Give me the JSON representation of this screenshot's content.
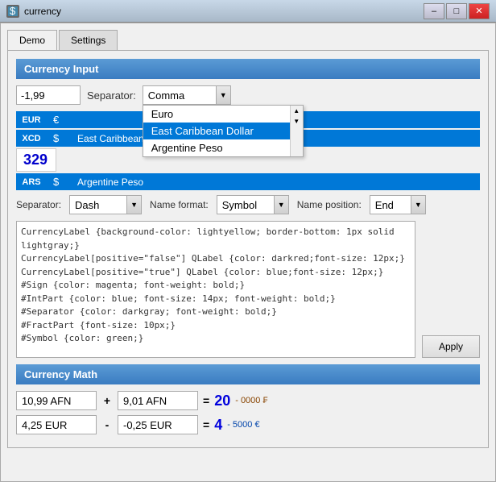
{
  "titleBar": {
    "title": "currency",
    "icon": "app-icon",
    "minimize": "–",
    "maximize": "□",
    "close": "✕"
  },
  "tabs": [
    {
      "id": "demo",
      "label": "Demo",
      "active": true
    },
    {
      "id": "settings",
      "label": "Settings",
      "active": false
    }
  ],
  "currencyInput": {
    "header": "Currency Input",
    "value": "-1,99",
    "separatorLabel": "Separator:",
    "selectedSeparator": "Comma",
    "dropdownOptions": [
      {
        "label": "Euro"
      },
      {
        "label": "East Caribbean Dollar"
      },
      {
        "label": "Argentine Peso"
      }
    ],
    "currencyBadge": "EUR",
    "currencySymbol": "€",
    "currencyName": "",
    "largeBadge1": "XCD",
    "symbol1": "$",
    "item1": "East Caribbean Dollar",
    "largeBadge2": "ARS",
    "symbol2": "$",
    "item2": "Argentine Peso",
    "largeValue": "329",
    "separatorOptionLabel": "Separator:",
    "separatorOption": "Dash",
    "nameFormatLabel": "Name format:",
    "nameFormatOption": "Symbol",
    "namePositionLabel": "Name position:",
    "namePositionOption": "End"
  },
  "styleSheet": {
    "content": "CurrencyLabel {background-color: lightyellow; border-bottom: 1px solid lightgray;}\nCurrencyLabel[positive=\"false\"] QLabel {color: darkred;font-size: 12px;}\nCurrencyLabel[positive=\"true\"] QLabel {color: blue;font-size: 12px;}\n#Sign {color: magenta; font-weight: bold;}\n#IntPart {color: blue; font-size: 14px; font-weight: bold;}\n#Separator {color: darkgray; font-weight: bold;}\n#FractPart {font-size: 10px;}\n#Symbol {color: green;}",
    "applyLabel": "Apply"
  },
  "currencyMath": {
    "header": "Currency Math",
    "row1": {
      "input1": "10,99 AFN",
      "operator": "+",
      "input2": "9,01 AFN",
      "equals": "=",
      "resultLarge": "20",
      "resultSmall": "- 0000 ₣"
    },
    "row2": {
      "input1": "4,25 EUR",
      "operator": "-",
      "input2": "-0,25 EUR",
      "equals": "=",
      "resultLarge": "4",
      "resultSmall": "- 5000 €"
    }
  },
  "colors": {
    "accent": "#0078d7",
    "sectionHeader": "#3a7cc1",
    "titleBar": "#a8b8c8",
    "closeBtn": "#c22222"
  }
}
